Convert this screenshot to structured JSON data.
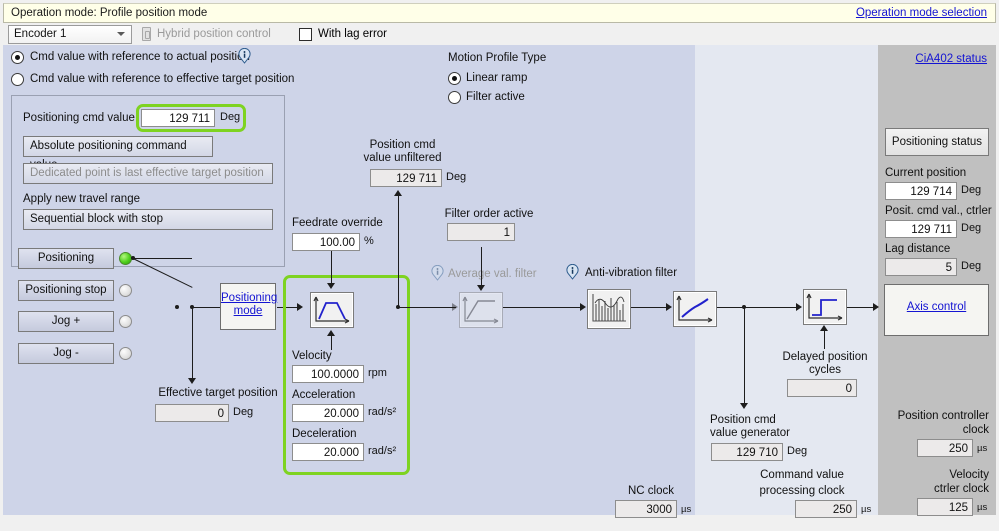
{
  "header": {
    "title": "Operation mode: Profile position mode",
    "link": "Operation mode selection"
  },
  "toolbar": {
    "encoder_select": "Encoder 1",
    "hybrid_label": "Hybrid position control",
    "lag_error_label": "With lag error"
  },
  "reference_options": {
    "option1": "Cmd value with reference to actual position",
    "option2": "Cmd value with reference to effective target position"
  },
  "motion_profile": {
    "title": "Motion Profile Type",
    "option1": "Linear ramp",
    "option2": "Filter active"
  },
  "cmd_group": {
    "positioning_cmd_label": "Positioning cmd value",
    "positioning_cmd_value": "129 711",
    "positioning_cmd_unit": "Deg",
    "absolute_btn": "Absolute positioning command value",
    "dedicated_btn": "Dedicated point is last effective target position",
    "apply_label": "Apply new travel range",
    "sequential_btn": "Sequential block with stop"
  },
  "commands": {
    "positioning": "Positioning",
    "positioning_stop": "Positioning stop",
    "jog_plus": "Jog +",
    "jog_minus": "Jog -"
  },
  "effective_target": {
    "label": "Effective target position",
    "value": "0",
    "unit": "Deg"
  },
  "positioning_mode_block": {
    "line1": "Positioning",
    "line2": "mode"
  },
  "feedrate": {
    "label": "Feedrate override",
    "value": "100.00",
    "unit": "%"
  },
  "position_cmd_unfiltered": {
    "label1": "Position cmd",
    "label2": "value unfiltered",
    "value": "129 711",
    "unit": "Deg"
  },
  "filter_order": {
    "label": "Filter order active",
    "value": "1"
  },
  "ramp": {
    "velocity_label": "Velocity",
    "velocity_value": "100.0000",
    "velocity_unit": "rpm",
    "accel_label": "Acceleration",
    "accel_value": "20.000",
    "accel_unit": "rad/s²",
    "decel_label": "Deceleration",
    "decel_value": "20.000",
    "decel_unit": "rad/s²"
  },
  "filters": {
    "average_label": "Average val. filter",
    "antivib_label": "Anti-vibration filter"
  },
  "delayed": {
    "label1": "Delayed position",
    "label2": "cycles",
    "value": "0"
  },
  "generator": {
    "label1": "Position cmd",
    "label2": "value generator",
    "value": "129 710",
    "unit": "Deg"
  },
  "clocks": {
    "nc_label": "NC clock",
    "nc_value": "3000",
    "nc_unit": "µs",
    "cmd_proc_label1": "Command value",
    "cmd_proc_label2": "processing clock",
    "cmd_proc_value": "250",
    "cmd_proc_unit": "µs",
    "pos_ctrl_label1": "Position controller",
    "pos_ctrl_label2": "clock",
    "pos_ctrl_value": "250",
    "pos_ctrl_unit": "µs",
    "vel_ctrl_label1": "Velocity",
    "vel_ctrl_label2": "ctrler clock",
    "vel_ctrl_value": "125",
    "vel_ctrl_unit": "µs"
  },
  "status_panel": {
    "cia402_link": "CiA402 status",
    "positioning_status_btn": "Positioning status",
    "current_position_label": "Current position",
    "current_position_value": "129 714",
    "current_position_unit": "Deg",
    "posit_cmd_label": "Posit. cmd val., ctrler",
    "posit_cmd_value": "129 711",
    "posit_cmd_unit": "Deg",
    "lag_label": "Lag distance",
    "lag_value": "5",
    "lag_unit": "Deg",
    "axis_control_link": "Axis control"
  },
  "colors": {
    "highlight": "#7ed321",
    "link": "#1414d2",
    "header_bg": "#ffffe8",
    "band_left": "#ced4e8",
    "band_mid": "#e4e8f1",
    "band_right": "#c0c0c0",
    "led_on": "#4ed01c"
  }
}
